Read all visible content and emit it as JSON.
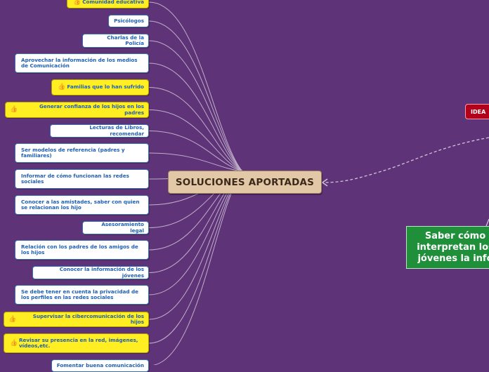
{
  "central_topic": "SOLUCIONES APORTADAS",
  "idea_node": "IDEA",
  "green_node": "Saber cómo interpretan los jóvenes la info",
  "colors": {
    "background": "#5f3377",
    "central": "#e3c8a7",
    "node_text": "#1f5fb4",
    "highlight": "#ffee22",
    "idea": "#b3001b",
    "green": "#1f8f3a"
  },
  "branches": [
    {
      "label": "Comunidad educativa",
      "highlighted": true
    },
    {
      "label": "Psicólogos",
      "highlighted": false
    },
    {
      "label": "Charlas de la Policía",
      "highlighted": false
    },
    {
      "label": "Aprovechar la información de los medios de Comunicación",
      "highlighted": false
    },
    {
      "label": "Familias que lo han sufrido",
      "highlighted": true
    },
    {
      "label": "Generar confianza de los hijos en los padres",
      "highlighted": true
    },
    {
      "label": "Lecturas de Libros, recomendar",
      "highlighted": false
    },
    {
      "label": "Ser modelos de referencia (padres y familiares)",
      "highlighted": false
    },
    {
      "label": "Informar de cómo funcionan las redes sociales",
      "highlighted": false
    },
    {
      "label": "Conocer a las amistades, saber con quien se relacionan los hijo",
      "highlighted": false
    },
    {
      "label": "Asesoramiento legal",
      "highlighted": false
    },
    {
      "label": "Relación con los padres de los amigos de los hijos",
      "highlighted": false
    },
    {
      "label": "Conocer la información de los jóvenes",
      "highlighted": false
    },
    {
      "label": "Se debe tener en cuenta la privacidad de los perfiles en las redes sociales",
      "highlighted": false
    },
    {
      "label": "Supervisar la cibercomunicación de los hijos",
      "highlighted": true
    },
    {
      "label": "Revisar su presencia en la red, imágenes, vídeos,etc.",
      "highlighted": true
    },
    {
      "label": "Fomentar buena comunicación",
      "highlighted": false
    }
  ]
}
